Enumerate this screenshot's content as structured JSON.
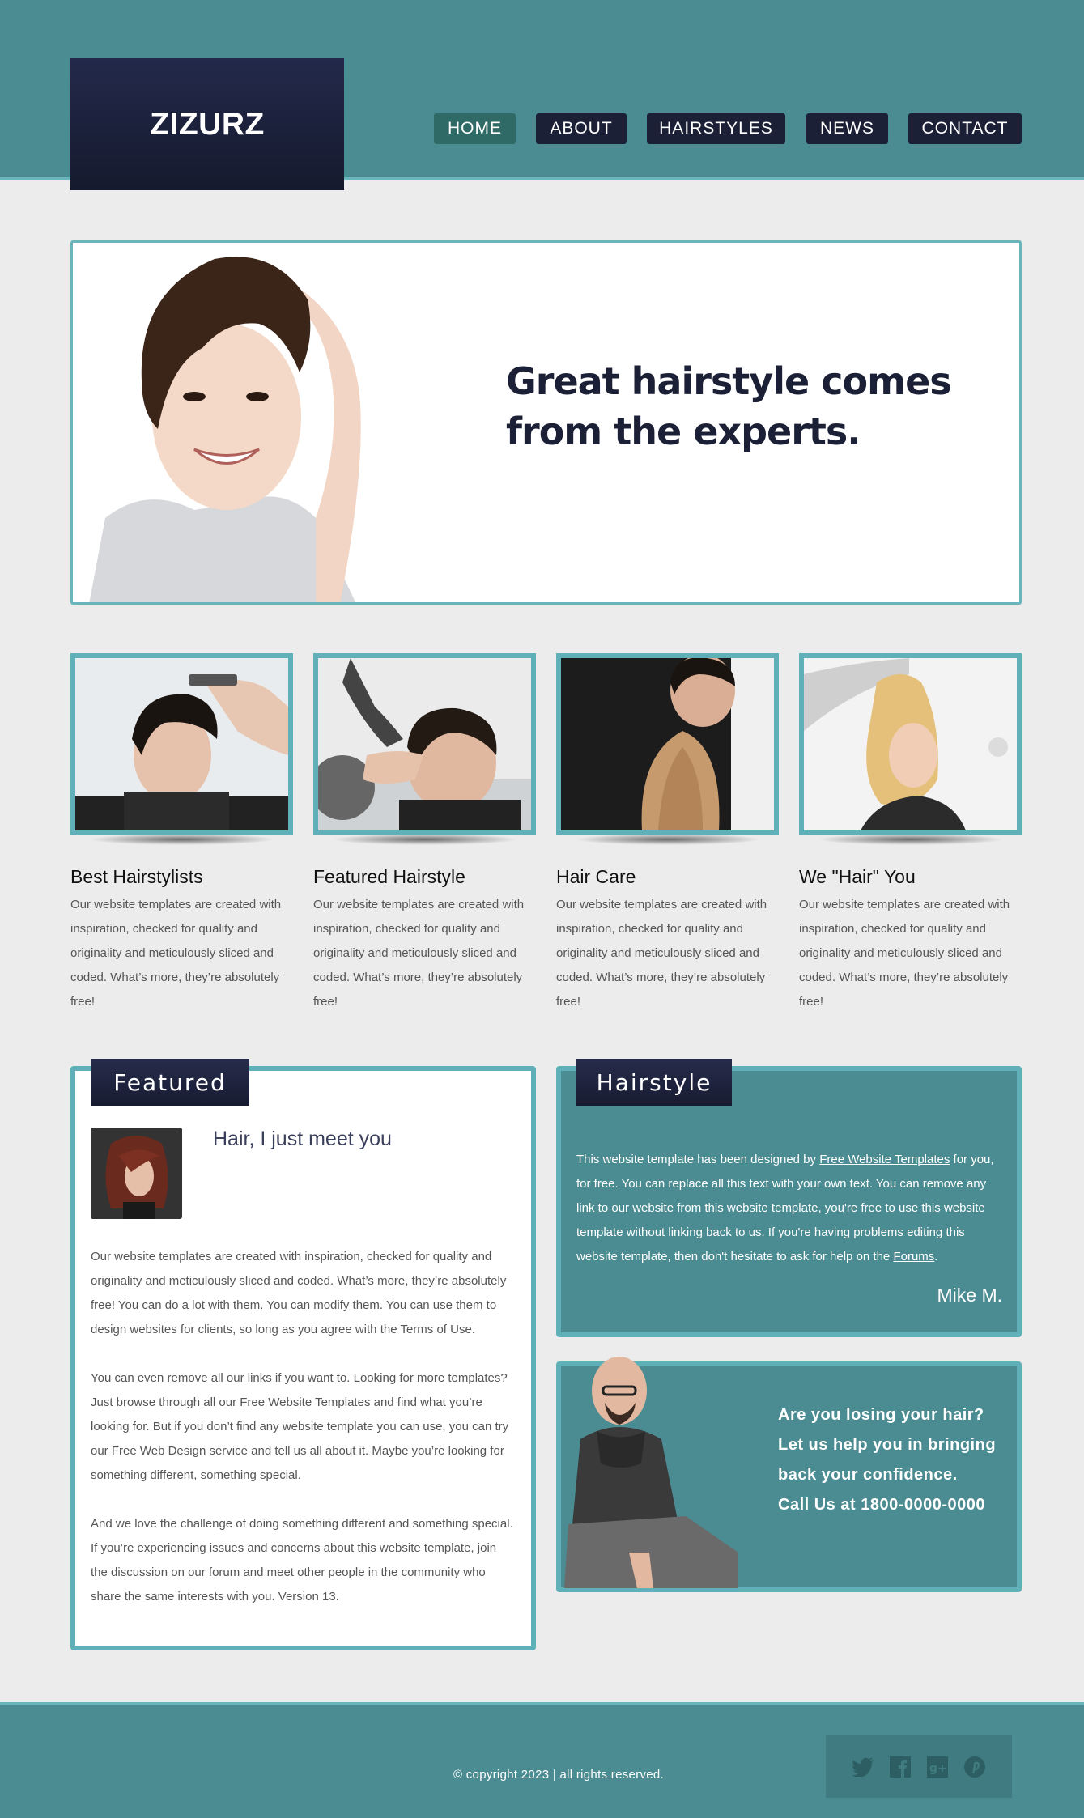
{
  "brand": {
    "logo_text": "ZIZURZ"
  },
  "nav": {
    "items": [
      {
        "label": "HOME",
        "active": true
      },
      {
        "label": "ABOUT",
        "active": false
      },
      {
        "label": "HAIRSTYLES",
        "active": false
      },
      {
        "label": "NEWS",
        "active": false
      },
      {
        "label": "CONTACT",
        "active": false
      }
    ]
  },
  "banner": {
    "headline_line1": "Great hairstyle comes",
    "headline_line2": "from the experts."
  },
  "features": [
    {
      "title": "Best Hairstylists",
      "text": "Our website templates are created with inspiration, checked for quality and originality and meticulously sliced and coded. What’s more, they’re absolutely free!"
    },
    {
      "title": "Featured Hairstyle",
      "text": "Our website templates are created with inspiration, checked for quality and originality and meticulously sliced and coded. What’s more, they’re absolutely free!"
    },
    {
      "title": "Hair Care",
      "text": "Our website templates are created with inspiration, checked for quality and originality and meticulously sliced and coded. What’s more, they’re absolutely free!"
    },
    {
      "title": "We \"Hair\" You",
      "text": "Our website templates are created with inspiration, checked for quality and originality and meticulously sliced and coded. What’s more, they’re absolutely free!"
    }
  ],
  "featured": {
    "tab_label": "Featured",
    "heading": "Hair, I just meet you",
    "paragraphs": [
      "Our website templates are created with inspiration, checked for quality and originality and meticulously sliced and coded. What’s more, they’re absolutely free! You can do a lot with them. You can modify them. You can use them to design websites for clients, so long as you agree with the Terms of Use.",
      "You can even remove all our links if you want to. Looking for more templates? Just browse through all our Free Website Templates and find what you’re looking for. But if you don’t find any website template you can use, you can try our Free Web Design service and tell us all about it. Maybe you’re looking for something different, something special.",
      "And we love the challenge of doing something different and something special. If you’re experiencing issues and concerns about this website template, join the discussion on our forum and meet other people in the community who share the same interests with you. Version 13."
    ]
  },
  "hairstyle": {
    "tab_label": "Hairstyle",
    "text_before_link1": "This website template has been designed by ",
    "link1": "Free Website Templates",
    "text_after_link1": " for you, for free. You can replace all this text with your own text. You can remove any link to our website from this website template, you're free to use this website template without linking back to us. If you're having problems editing this website template, then don't hesitate to ask for help on the ",
    "link2": "Forums",
    "text_end": ".",
    "signature": "Mike M."
  },
  "promo": {
    "line1": "Are you losing your hair?",
    "line2": "Let us help you in bringing",
    "line3": "back your confidence.",
    "line4": "Call Us at 1800-0000-0000"
  },
  "footer": {
    "copyright": "© copyright 2023 | all rights reserved.",
    "social_icons": [
      "twitter-icon",
      "facebook-icon",
      "google-plus-icon",
      "pinterest-icon"
    ]
  },
  "colors": {
    "teal": "#4b8c92",
    "teal_border": "#5fb0b8",
    "navy": "#1c2036",
    "page_bg": "#ececec"
  }
}
